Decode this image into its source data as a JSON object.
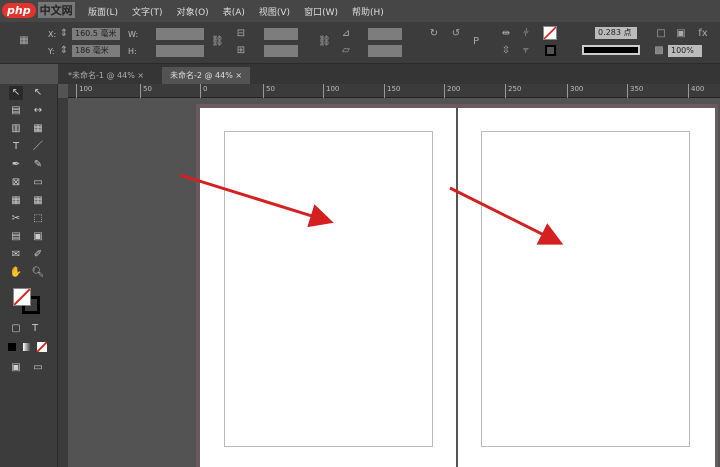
{
  "logo": {
    "brand": "php",
    "suffix": "中文网"
  },
  "menu": [
    "版面(L)",
    "文字(T)",
    "对象(O)",
    "表(A)",
    "视图(V)",
    "窗口(W)",
    "帮助(H)"
  ],
  "control": {
    "x_label": "X:",
    "x_value": "160.5 毫米",
    "y_label": "Y:",
    "y_value": "186 毫米",
    "w_label": "W:",
    "h_label": "H:",
    "stroke_weight": "0.283 点",
    "opacity": "100%"
  },
  "tabs": [
    {
      "label": "*未命名-1 @ 44%",
      "close": "×",
      "active": false
    },
    {
      "label": "未命名-2 @ 44%",
      "close": "×",
      "active": true
    }
  ],
  "ruler": [
    "100",
    "50",
    "0",
    "50",
    "100",
    "150",
    "200",
    "250",
    "300",
    "350",
    "400"
  ],
  "colors": {
    "canvas": "#535353",
    "arrow": "#d42020",
    "page": "#ffffff"
  }
}
